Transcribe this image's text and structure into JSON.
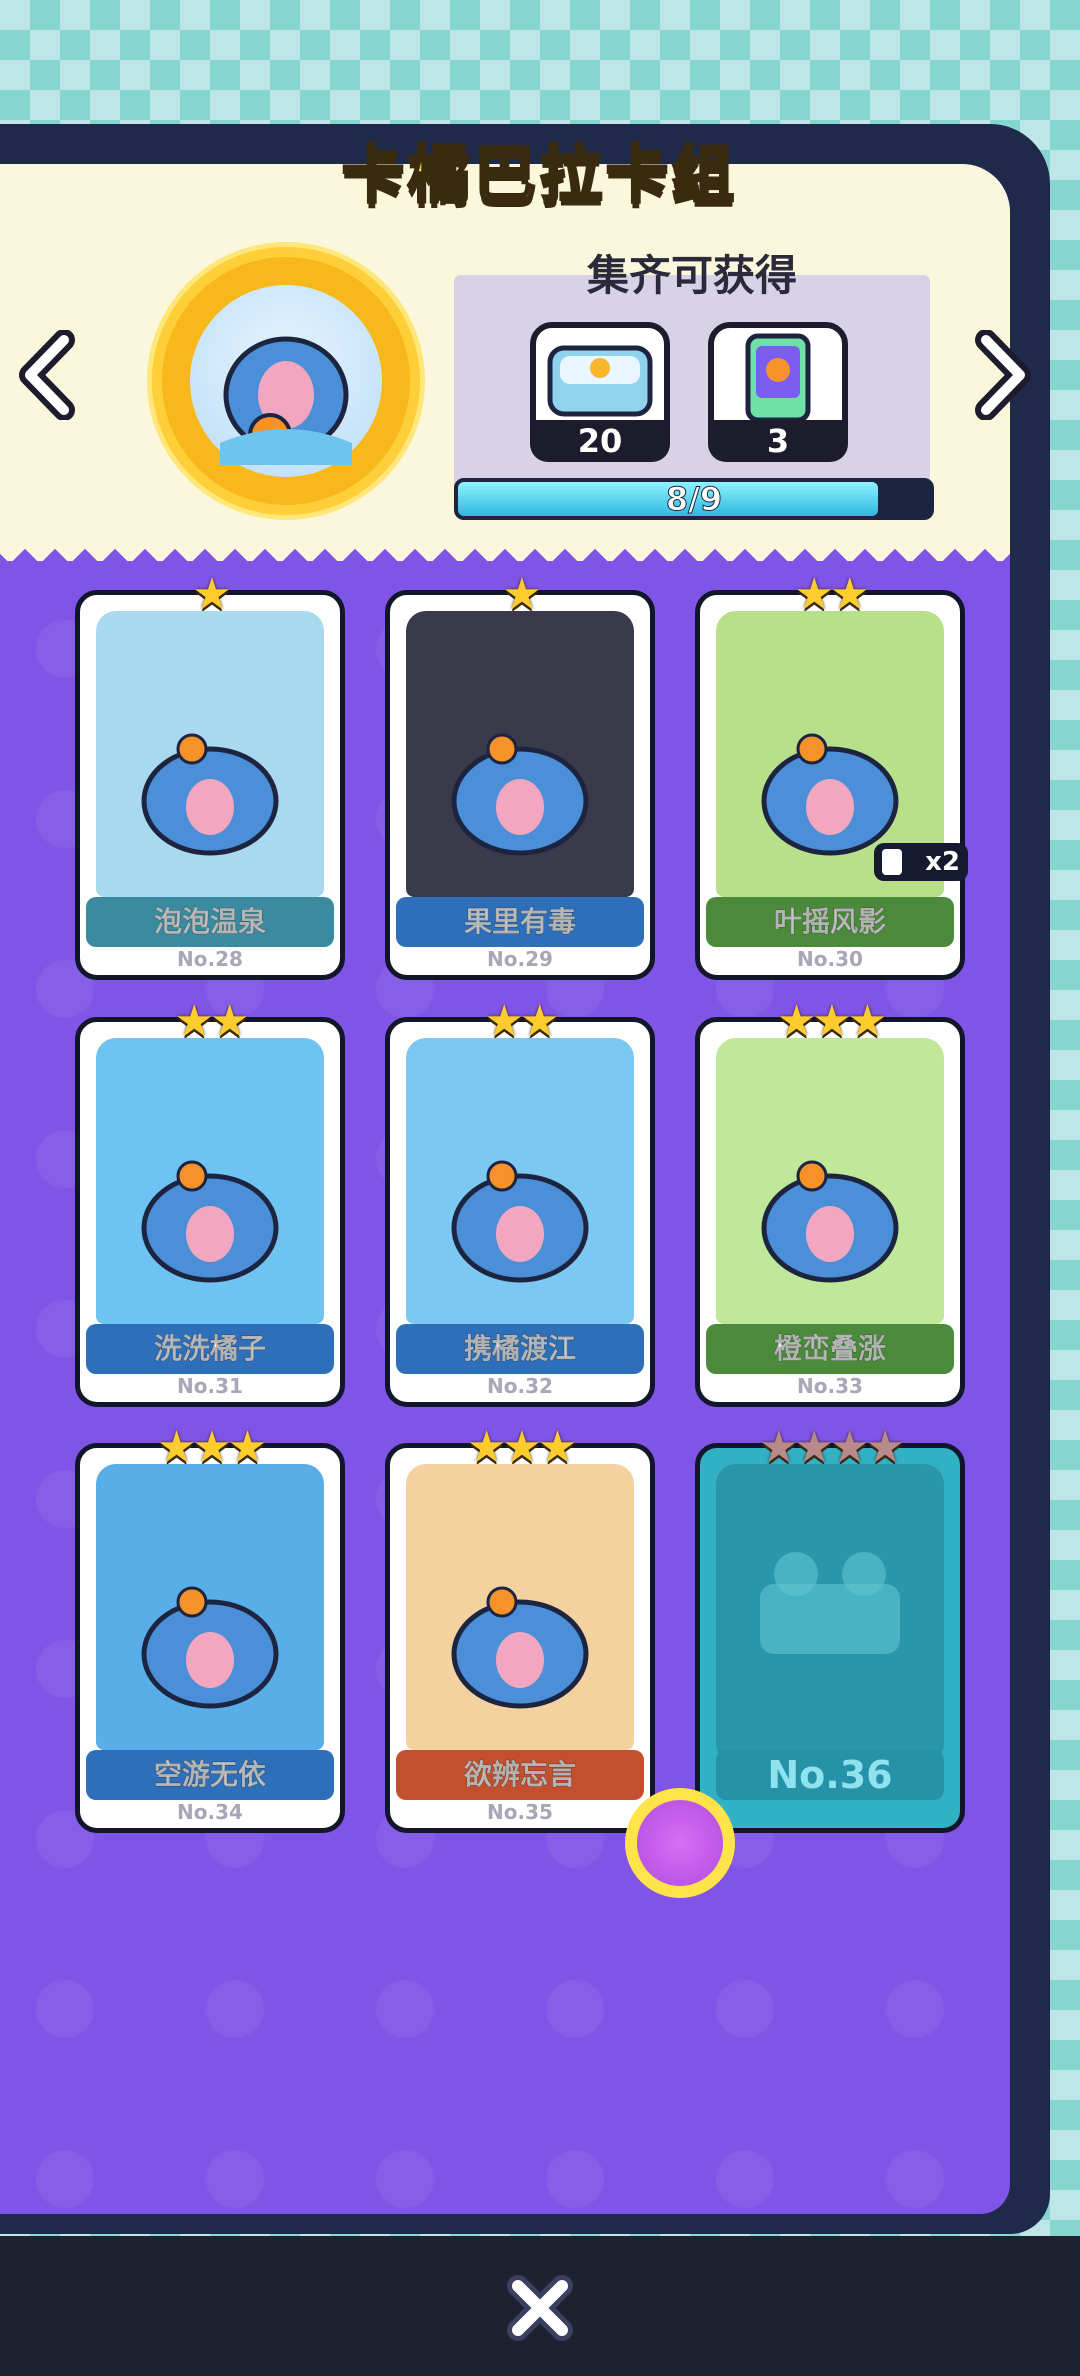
{
  "header": {
    "title": "卡橘巴拉卡组"
  },
  "reward_panel": {
    "title": "集齐可获得",
    "rewards": [
      {
        "icon": "treasure-chest-icon",
        "count": "20"
      },
      {
        "icon": "phone-card-icon",
        "count": "3"
      }
    ],
    "progress_text": "8/9",
    "progress_fraction": 0.889
  },
  "cards": [
    {
      "name": "泡泡温泉",
      "no": "No.28",
      "stars": "★",
      "theme": "#3a8aa0",
      "art": "#a9d9ee"
    },
    {
      "name": "果里有毒",
      "no": "No.29",
      "stars": "★",
      "theme": "#2d6fb8",
      "art": "#3b3a4a"
    },
    {
      "name": "叶摇风影",
      "no": "No.30",
      "stars": "★★",
      "theme": "#4a8a3a",
      "art": "#b8e08a",
      "dupe": "x2"
    },
    {
      "name": "洗洗橘子",
      "no": "No.31",
      "stars": "★★",
      "theme": "#2d6fb8",
      "art": "#6ec3f0"
    },
    {
      "name": "携橘渡江",
      "no": "No.32",
      "stars": "★★",
      "theme": "#2d6fb8",
      "art": "#7cc8f2"
    },
    {
      "name": "橙峦叠涨",
      "no": "No.33",
      "stars": "★★★",
      "theme": "#4a8a3a",
      "art": "#bfe89a"
    },
    {
      "name": "空游无依",
      "no": "No.34",
      "stars": "★★★",
      "theme": "#2d6fb8",
      "art": "#5aaee8"
    },
    {
      "name": "欲辨忘言",
      "no": "No.35",
      "stars": "★★★",
      "theme": "#c2502e",
      "art": "#f3d2a0"
    }
  ],
  "locked_card": {
    "no": "No.36",
    "stars": "★★★★"
  },
  "colors": {
    "purple_bg": "#8054e6",
    "cream": "#fbf7dc",
    "gold": "#ffd93a"
  }
}
